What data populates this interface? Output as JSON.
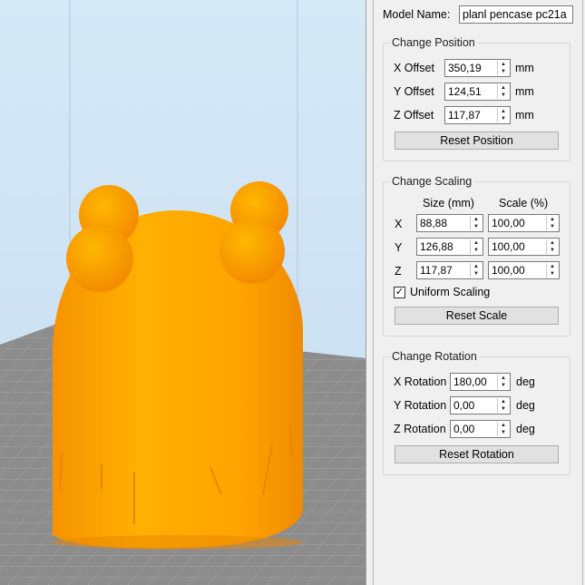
{
  "model": {
    "label": "Model Name:",
    "value": "planl pencase pc21a"
  },
  "position": {
    "title": "Change Position",
    "rows": [
      {
        "label": "X Offset",
        "value": "350,19",
        "unit": "mm"
      },
      {
        "label": "Y Offset",
        "value": "124,51",
        "unit": "mm"
      },
      {
        "label": "Z Offset",
        "value": "117,87",
        "unit": "mm"
      }
    ],
    "reset": "Reset Position"
  },
  "scaling": {
    "title": "Change Scaling",
    "size_header": "Size (mm)",
    "scale_header": "Scale (%)",
    "rows": [
      {
        "axis": "X",
        "size": "88,88",
        "scale": "100,00"
      },
      {
        "axis": "Y",
        "size": "126,88",
        "scale": "100,00"
      },
      {
        "axis": "Z",
        "size": "117,87",
        "scale": "100,00"
      }
    ],
    "uniform_label": "Uniform Scaling",
    "uniform_checked": true,
    "reset": "Reset Scale"
  },
  "rotation": {
    "title": "Change Rotation",
    "rows": [
      {
        "label": "X Rotation",
        "value": "180,00",
        "unit": "deg"
      },
      {
        "label": "Y Rotation",
        "value": "0,00",
        "unit": "deg"
      },
      {
        "label": "Z Rotation",
        "value": "0,00",
        "unit": "deg"
      }
    ],
    "reset": "Reset Rotation"
  },
  "colors": {
    "sky": "#cfe3f2",
    "bed": "#8c8c8c",
    "model": "#ffa600"
  },
  "icons": {
    "spin_up": "triangle-up",
    "spin_down": "triangle-down",
    "check": "check-mark"
  }
}
